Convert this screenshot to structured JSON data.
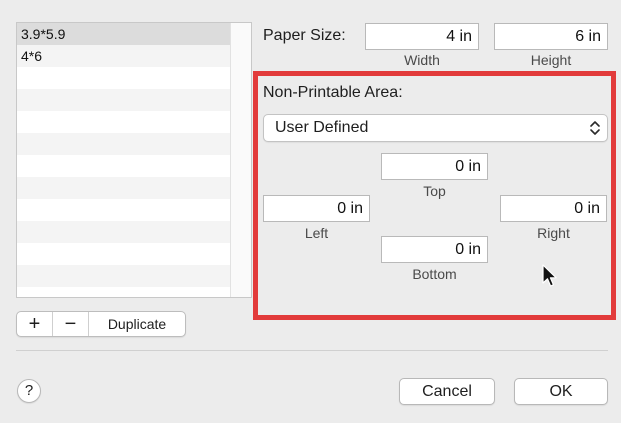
{
  "paper_list": {
    "items": [
      "3.9*5.9",
      "4*6"
    ],
    "selected_index": 0,
    "empty_rows": 10
  },
  "list_controls": {
    "add_label": "+",
    "remove_label": "−",
    "duplicate_label": "Duplicate"
  },
  "paper_size": {
    "label": "Paper Size:",
    "width_value": "4 in",
    "width_label": "Width",
    "height_value": "6 in",
    "height_label": "Height"
  },
  "non_printable": {
    "label": "Non-Printable Area:",
    "popup_value": "User Defined",
    "top_value": "0 in",
    "top_label": "Top",
    "left_value": "0 in",
    "left_label": "Left",
    "right_value": "0 in",
    "right_label": "Right",
    "bottom_value": "0 in",
    "bottom_label": "Bottom",
    "highlight_color": "#e23b3b"
  },
  "footer": {
    "help_label": "?",
    "cancel_label": "Cancel",
    "ok_label": "OK"
  },
  "icons": {
    "chevron": "chevron-up-down-icon",
    "cursor": "mouse-pointer-icon"
  }
}
